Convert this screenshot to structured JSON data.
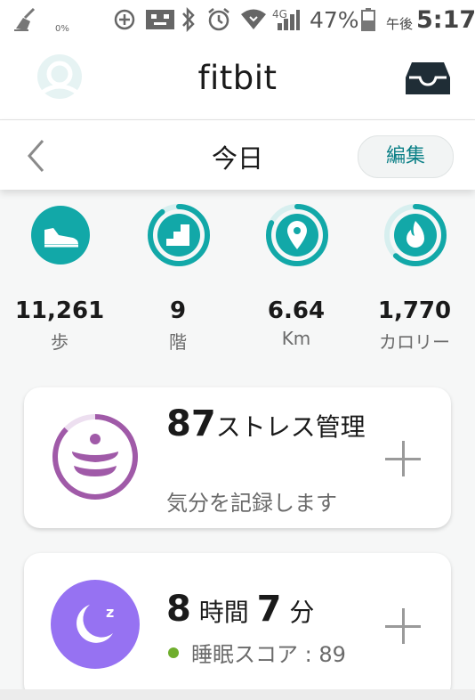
{
  "status_bar": {
    "data_saver_sub": "0%",
    "network": "4G",
    "battery_percent": "47%",
    "ampm": "午後",
    "time": "5:17"
  },
  "app_bar": {
    "title": "fitbit"
  },
  "day_bar": {
    "title": "今日",
    "edit_label": "編集"
  },
  "stats": [
    {
      "value": "11,261",
      "unit": "歩",
      "icon": "shoe-icon",
      "progress": 1.0
    },
    {
      "value": "9",
      "unit": "階",
      "icon": "stairs-icon",
      "progress": 0.9
    },
    {
      "value": "6.64",
      "unit": "Km",
      "icon": "location-pin-icon",
      "progress": 0.82
    },
    {
      "value": "1,770",
      "unit": "カロリー",
      "icon": "flame-icon",
      "progress": 0.62
    }
  ],
  "stress_card": {
    "score": "87",
    "title": "ストレス管理",
    "subtitle": "気分を記録します",
    "progress": 0.87
  },
  "sleep_card": {
    "hours": "8",
    "hours_unit": "時間",
    "minutes": "7",
    "minutes_unit": "分",
    "score_text": "睡眠スコア : 89"
  },
  "colors": {
    "teal": "#12a8a8",
    "teal_track": "#d7efef",
    "stress_purple": "#a05aa8",
    "sleep_purple": "#9672f2",
    "edit_text": "#0a7f86",
    "sleep_dot": "#6fae2d"
  }
}
